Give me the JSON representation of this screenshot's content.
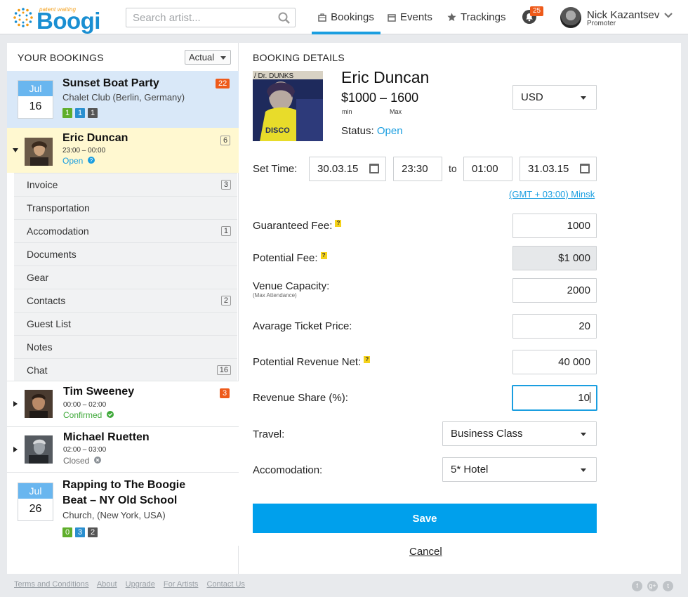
{
  "header": {
    "logo_word": "Boogi",
    "logo_tag": "patent waiting",
    "search_placeholder": "Search artist...",
    "nav": [
      {
        "label": "Bookings",
        "icon": "briefcase-icon",
        "active": true
      },
      {
        "label": "Events",
        "icon": "calendar-icon"
      },
      {
        "label": "Trackings",
        "icon": "star-icon"
      }
    ],
    "notifications": "25",
    "user_name": "Nick Kazantsev",
    "user_role": "Promoter"
  },
  "bookings": {
    "title": "YOUR BOOKINGS",
    "filter": "Actual",
    "events": [
      {
        "month": "Jul",
        "day": "16",
        "title": "Sunset Boat Party",
        "venue": "Chalet Club (Berlin, Germany)",
        "count": "22",
        "tags": [
          "1",
          "1",
          "1"
        ]
      },
      {
        "month": "Jul",
        "day": "26",
        "title_line1": "Rapping to The Boogie",
        "title_line2": "Beat – NY Old School",
        "venue": "Church, (New York, USA)",
        "tags": [
          "0",
          "3",
          "2"
        ]
      }
    ],
    "artists": [
      {
        "name": "Eric Duncan",
        "time": "23:00 – 00:00",
        "status": "Open",
        "count": "6"
      },
      {
        "name": "Tim Sweeney",
        "time": "00:00 – 02:00",
        "status": "Confirmed",
        "count": "3"
      },
      {
        "name": "Michael Ruetten",
        "time": "02:00 – 03:00",
        "status": "Closed"
      }
    ],
    "sub_items": [
      {
        "label": "Invoice",
        "count": "3"
      },
      {
        "label": "Transportation"
      },
      {
        "label": "Accomodation",
        "count": "1"
      },
      {
        "label": "Documents"
      },
      {
        "label": "Gear"
      },
      {
        "label": "Contacts",
        "count": "2"
      },
      {
        "label": "Guest List"
      },
      {
        "label": "Notes"
      },
      {
        "label": "Chat",
        "count": "16"
      }
    ]
  },
  "details": {
    "title": "BOOKING DETAILS",
    "art_text": "/ Dr. DUNKS",
    "artist": "Eric Duncan",
    "range": "$1000 – 1600",
    "min_label": "min",
    "max_label": "Max",
    "currency": "USD",
    "status_label": "Status:",
    "status_value": "Open",
    "set_time_label": "Set Time:",
    "start_date": "30.03.15",
    "start_time": "23:30",
    "to_label": "to",
    "end_time": "01:00",
    "end_date": "31.03.15",
    "timezone": "(GMT + 03:00) Minsk",
    "fields": {
      "guaranteed_fee": {
        "label": "Guaranteed Fee:",
        "value": "1000"
      },
      "potential_fee": {
        "label": "Potential Fee:",
        "value": "$1 000"
      },
      "venue_capacity": {
        "label": "Venue Capacity:",
        "note": "(Max Attendance)",
        "value": "2000"
      },
      "avg_ticket": {
        "label": "Avarage Ticket Price:",
        "value": "20"
      },
      "revenue_net": {
        "label": "Potential Revenue Net:",
        "value": "40 000"
      },
      "revenue_share": {
        "label": "Revenue Share (%):",
        "value": "10"
      },
      "travel": {
        "label": "Travel:",
        "value": "Business Class"
      },
      "accomodation": {
        "label": "Accomodation:",
        "value": "5* Hotel"
      }
    },
    "help_mark": "?",
    "save_label": "Save",
    "cancel_label": "Cancel"
  },
  "footer": {
    "links": [
      "Terms and Conditions",
      "About",
      "Upgrade",
      "For Artists",
      "Contact Us"
    ],
    "social": [
      "f",
      "g+",
      "t"
    ]
  },
  "colors": {
    "accent": "#1a9ee0",
    "badge": "#ee5a1a",
    "selected_event": "#d9e8f8",
    "selected_artist": "#fff8d0"
  }
}
